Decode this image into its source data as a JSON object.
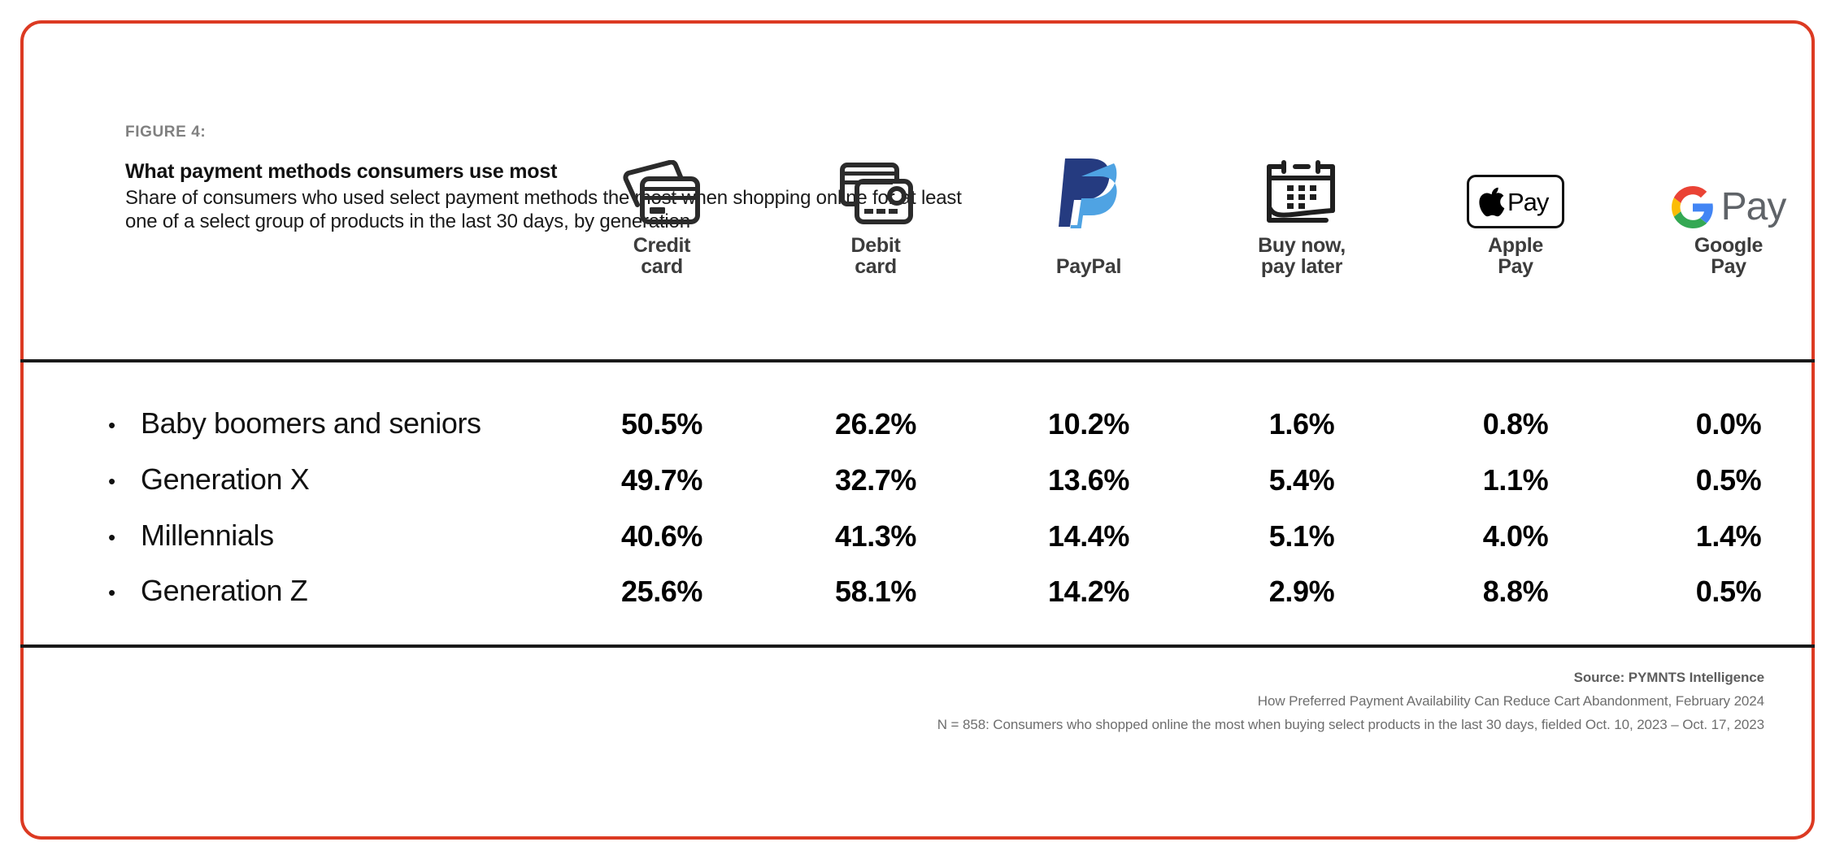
{
  "figure": {
    "label": "FIGURE 4:",
    "title": "What payment methods consumers use most",
    "subtitle": "Share of consumers who used select payment methods the most when shopping online for at least one of a select group of products in the last 30 days, by generation",
    "border_color": "#DC3A22"
  },
  "columns": [
    {
      "icon": "credit-card-icon",
      "label_line1": "Credit",
      "label_line2": "card"
    },
    {
      "icon": "debit-card-icon",
      "label_line1": "Debit",
      "label_line2": "card"
    },
    {
      "icon": "paypal-logo-icon",
      "label_line1": "PayPal",
      "label_line2": ""
    },
    {
      "icon": "calendar-icon",
      "label_line1": "Buy now,",
      "label_line2": "pay later"
    },
    {
      "icon": "apple-pay-logo-icon",
      "label_line1": "Apple",
      "label_line2": "Pay"
    },
    {
      "icon": "google-pay-logo-icon",
      "label_line1": "Google",
      "label_line2": "Pay"
    }
  ],
  "rows": [
    {
      "bullet": "•",
      "label": "Baby boomers and seniors",
      "values": [
        "50.5%",
        "26.2%",
        "10.2%",
        "1.6%",
        "0.8%",
        "0.0%"
      ]
    },
    {
      "bullet": "•",
      "label": "Generation X",
      "values": [
        "49.7%",
        "32.7%",
        "13.6%",
        "5.4%",
        "1.1%",
        "0.5%"
      ]
    },
    {
      "bullet": "•",
      "label": "Millennials",
      "values": [
        "40.6%",
        "41.3%",
        "14.4%",
        "5.1%",
        "4.0%",
        "1.4%"
      ]
    },
    {
      "bullet": "•",
      "label": "Generation Z",
      "values": [
        "25.6%",
        "58.1%",
        "14.2%",
        "2.9%",
        "8.8%",
        "0.5%"
      ]
    }
  ],
  "footnotes": {
    "source": "Source: PYMNTS Intelligence",
    "report": "How Preferred Payment Availability Can Reduce Cart Abandonment, February 2024",
    "sample": "N = 858: Consumers who shopped online the most when buying select products in the last 30 days, fielded Oct. 10, 2023 – Oct. 17, 2023"
  },
  "chart_data": {
    "type": "table",
    "title": "What payment methods consumers use most",
    "subtitle": "Share of consumers who used select payment methods the most when shopping online for at least one of a select group of products in the last 30 days, by generation",
    "categories": [
      "Baby boomers and seniors",
      "Generation X",
      "Millennials",
      "Generation Z"
    ],
    "series": [
      {
        "name": "Credit card",
        "values": [
          50.5,
          49.7,
          40.6,
          25.6
        ]
      },
      {
        "name": "Debit card",
        "values": [
          26.2,
          32.7,
          41.3,
          58.1
        ]
      },
      {
        "name": "PayPal",
        "values": [
          10.2,
          13.6,
          14.4,
          14.2
        ]
      },
      {
        "name": "Buy now, pay later",
        "values": [
          1.6,
          5.4,
          5.1,
          2.9
        ]
      },
      {
        "name": "Apple Pay",
        "values": [
          0.8,
          1.1,
          4.0,
          8.8
        ]
      },
      {
        "name": "Google Pay",
        "values": [
          0.0,
          0.5,
          1.4,
          0.5
        ]
      }
    ],
    "unit": "percent",
    "xlabel": "Payment method",
    "ylabel": "Share of consumers"
  }
}
